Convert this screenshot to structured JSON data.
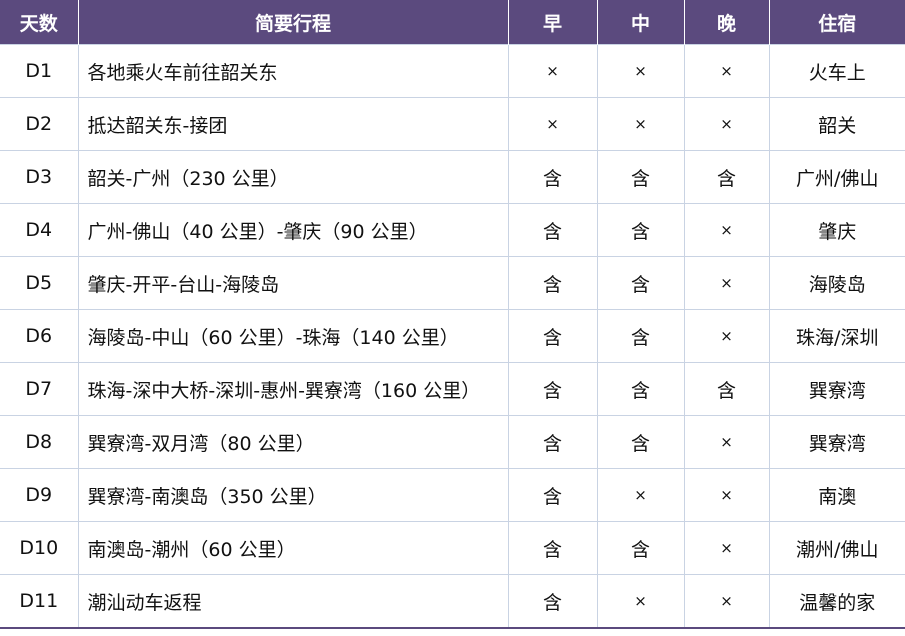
{
  "header": {
    "day": "天数",
    "route": "简要行程",
    "breakfast": "早",
    "lunch": "中",
    "dinner": "晚",
    "stay": "住宿"
  },
  "rows": [
    {
      "day": "D1",
      "route": "各地乘火车前往韶关东",
      "breakfast": "×",
      "lunch": "×",
      "dinner": "×",
      "stay": "火车上"
    },
    {
      "day": "D2",
      "route": "抵达韶关东-接团",
      "breakfast": "×",
      "lunch": "×",
      "dinner": "×",
      "stay": "韶关"
    },
    {
      "day": "D3",
      "route": "韶关-广州（230 公里）",
      "breakfast": "含",
      "lunch": "含",
      "dinner": "含",
      "stay": "广州/佛山"
    },
    {
      "day": "D4",
      "route": "广州-佛山（40 公里）-肇庆（90 公里）",
      "breakfast": "含",
      "lunch": "含",
      "dinner": "×",
      "stay": "肇庆"
    },
    {
      "day": "D5",
      "route": "肇庆-开平-台山-海陵岛",
      "breakfast": "含",
      "lunch": "含",
      "dinner": "×",
      "stay": "海陵岛"
    },
    {
      "day": "D6",
      "route": "海陵岛-中山（60 公里）-珠海（140 公里）",
      "breakfast": "含",
      "lunch": "含",
      "dinner": "×",
      "stay": "珠海/深圳"
    },
    {
      "day": "D7",
      "route": "珠海-深中大桥-深圳-惠州-巽寮湾（160 公里）",
      "breakfast": "含",
      "lunch": "含",
      "dinner": "含",
      "stay": "巽寮湾"
    },
    {
      "day": "D8",
      "route": "巽寮湾-双月湾（80 公里）",
      "breakfast": "含",
      "lunch": "含",
      "dinner": "×",
      "stay": "巽寮湾"
    },
    {
      "day": "D9",
      "route": "巽寮湾-南澳岛（350 公里）",
      "breakfast": "含",
      "lunch": "×",
      "dinner": "×",
      "stay": "南澳"
    },
    {
      "day": "D10",
      "route": "南澳岛-潮州（60 公里）",
      "breakfast": "含",
      "lunch": "含",
      "dinner": "×",
      "stay": "潮州/佛山"
    },
    {
      "day": "D11",
      "route": "潮汕动车返程",
      "breakfast": "含",
      "lunch": "×",
      "dinner": "×",
      "stay": "温馨的家"
    }
  ]
}
